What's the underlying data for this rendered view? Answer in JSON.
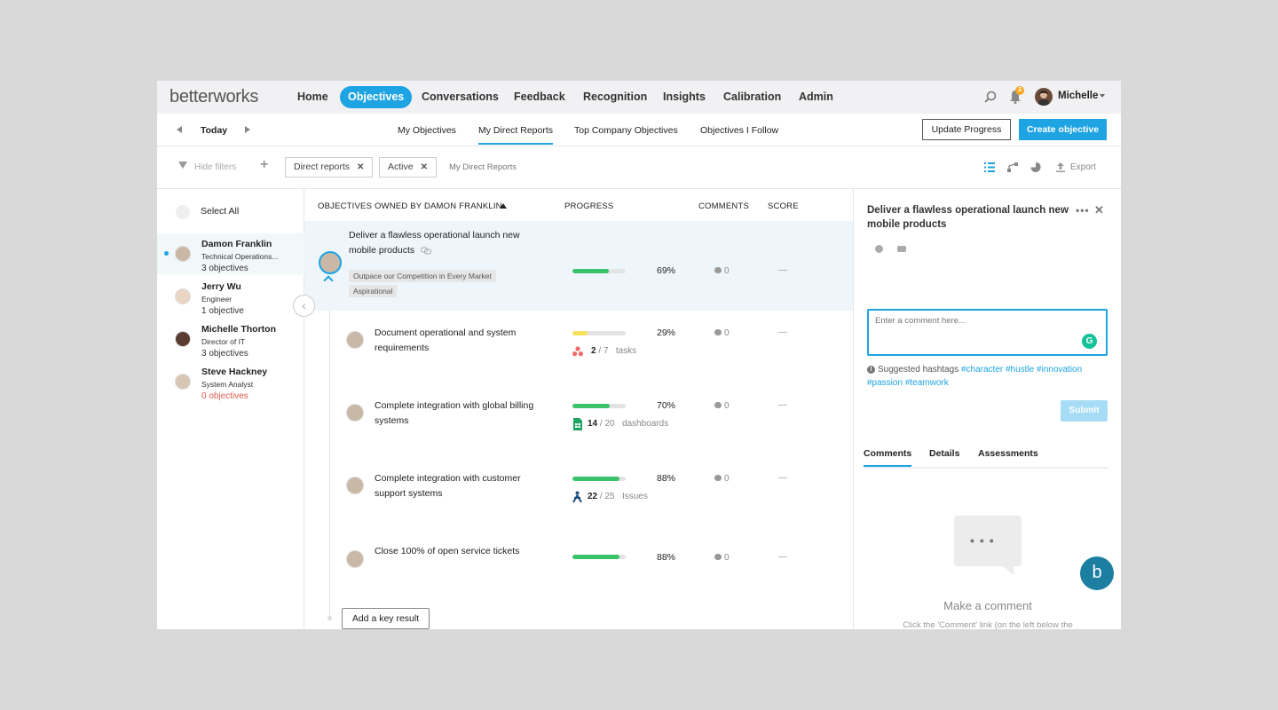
{
  "nav": {
    "logo": "betterworks",
    "items": [
      {
        "label": "Home"
      },
      {
        "label": "Objectives"
      },
      {
        "label": "Conversations"
      },
      {
        "label": "Feedback"
      },
      {
        "label": "Recognition"
      },
      {
        "label": "Insights"
      },
      {
        "label": "Calibration"
      },
      {
        "label": "Admin"
      }
    ],
    "active": "Objectives",
    "notification_count": "3",
    "user": "Michelle"
  },
  "subnav": {
    "date_label": "Today",
    "tabs": [
      {
        "label": "My Objectives"
      },
      {
        "label": "My Direct Reports"
      },
      {
        "label": "Top Company Objectives"
      },
      {
        "label": "Objectives I Follow"
      }
    ],
    "active_tab": "My Direct Reports",
    "update_progress": "Update Progress",
    "create_objective": "Create objective"
  },
  "filters": {
    "hide_filters": "Hide filters",
    "chips": [
      "Direct reports",
      "Active"
    ],
    "label": "My Direct Reports",
    "export": "Export"
  },
  "people": {
    "select_all": "Select All",
    "list": [
      {
        "name": "Damon Franklin",
        "role": "Technical Operations...",
        "count": "3 objectives"
      },
      {
        "name": "Jerry Wu",
        "role": "Engineer",
        "count": "1 objective"
      },
      {
        "name": "Michelle Thorton",
        "role": "Director of IT",
        "count": "3 objectives"
      },
      {
        "name": "Steve Hackney",
        "role": "System Analyst",
        "count": "0 objectives"
      }
    ]
  },
  "table": {
    "headers": {
      "objective": "OBJECTIVES OWNED BY DAMON FRANKLIN",
      "progress": "PROGRESS",
      "comments": "COMMENTS",
      "score": "SCORE"
    },
    "objective": {
      "title": "Deliver a flawless operational launch new mobile products",
      "tags": [
        "Outpace our Competition in Every Market",
        "Aspirational"
      ],
      "progress": 69,
      "progress_label": "69%",
      "comments": "0",
      "score": "—"
    },
    "key_results": [
      {
        "title": "Document operational and system requirements",
        "progress": 29,
        "progress_label": "29%",
        "color": "#f5e15a",
        "integ_done": "2",
        "integ_total": "/ 7",
        "integ_unit": "tasks",
        "comments": "0",
        "score": "—"
      },
      {
        "title": "Complete integration with global billing systems",
        "progress": 70,
        "progress_label": "70%",
        "color": "#3ac36b",
        "integ_done": "14",
        "integ_total": "/ 20",
        "integ_unit": "dashboards",
        "comments": "0",
        "score": "—"
      },
      {
        "title": "Complete integration with customer support systems",
        "progress": 88,
        "progress_label": "88%",
        "color": "#3ac36b",
        "integ_done": "22",
        "integ_total": "/ 25",
        "integ_unit": "Issues",
        "comments": "0",
        "score": "—"
      },
      {
        "title": "Close 100% of open service tickets",
        "progress": 88,
        "progress_label": "88%",
        "color": "#3ac36b",
        "comments": "0",
        "score": "—"
      }
    ],
    "add_key_result": "Add a key result"
  },
  "detail": {
    "title": "Deliver a flawless operational launch new mobile products",
    "comment_placeholder": "Enter a comment here...",
    "suggested_label": "Suggested hashtags",
    "hashtags": [
      "#character",
      "#hustle",
      "#innovation",
      "#passion",
      "#teamwork"
    ],
    "submit": "Submit",
    "tabs": [
      "Comments",
      "Details",
      "Assessments"
    ],
    "active_tab": "Comments",
    "empty_title": "Make a comment",
    "empty_sub": "Click the 'Comment' link (on the left below the"
  },
  "colors": {
    "accent": "#1ea3e3",
    "progress_green": "#3ac36b",
    "progress_yellow": "#f5e15a",
    "warning_red": "#e05a4f"
  }
}
